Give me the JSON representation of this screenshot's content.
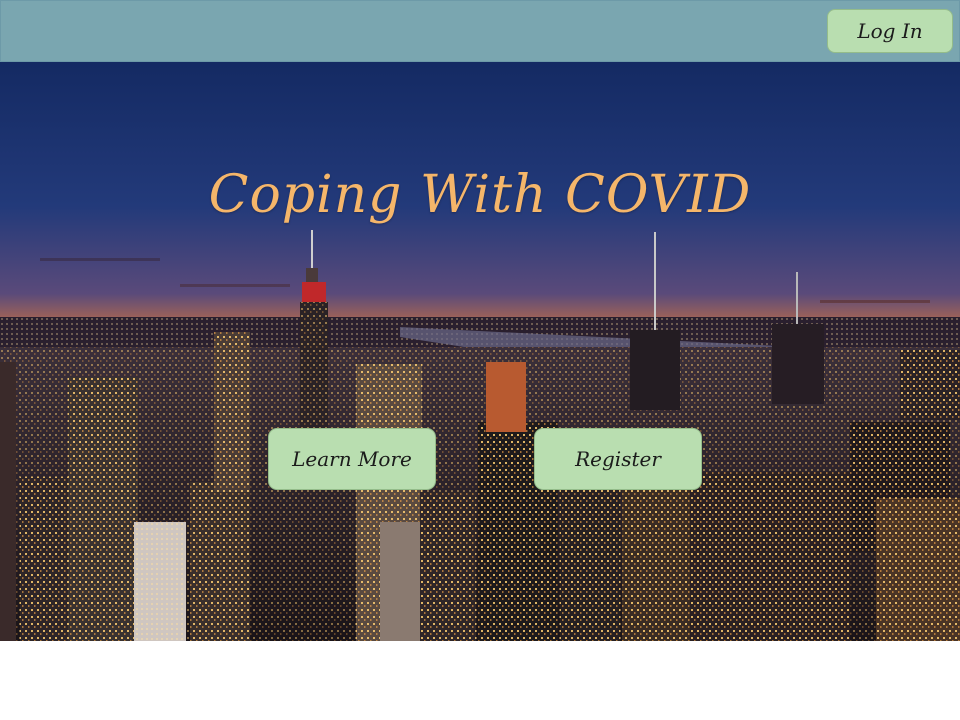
{
  "header": {
    "login_label": "Log In"
  },
  "hero": {
    "title": "Coping With COVID",
    "image": "new-york-city-skyline-at-sunset"
  },
  "actions": {
    "learn_more_label": "Learn More",
    "register_label": "Register"
  },
  "colors": {
    "header_bg": "#7aa6b0",
    "button_bg": "#b9deb0",
    "title": "#f5b66a"
  }
}
